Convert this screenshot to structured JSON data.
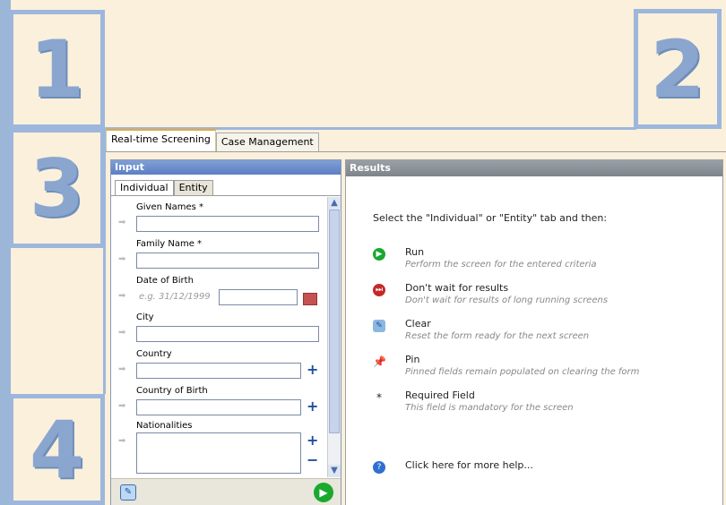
{
  "callouts": {
    "one": "1",
    "two": "2",
    "three": "3",
    "four": "4"
  },
  "tabs": [
    {
      "label": "Real-time Screening",
      "active": true
    },
    {
      "label": "Case Management",
      "active": false
    }
  ],
  "input_panel": {
    "title": "Input",
    "subtabs": [
      {
        "label": "Individual",
        "active": true
      },
      {
        "label": "Entity",
        "active": false
      }
    ],
    "fields": {
      "given_names": "Given Names *",
      "family_name": "Family Name *",
      "date_of_birth": "Date of Birth",
      "dob_placeholder": "e.g. 31/12/1999",
      "city": "City",
      "country": "Country",
      "country_of_birth": "Country of Birth",
      "nationalities": "Nationalities"
    },
    "add_symbol": "+",
    "remove_symbol": "−"
  },
  "results_panel": {
    "title": "Results",
    "instruction": "Select the \"Individual\" or \"Entity\" tab and then:",
    "legend": [
      {
        "title": "Run",
        "desc": "Perform the screen for the entered criteria",
        "icon": "run-icon"
      },
      {
        "title": "Don't wait for results",
        "desc": "Don't wait for results of long running screens",
        "icon": "skip-icon"
      },
      {
        "title": "Clear",
        "desc": "Reset the form ready for the next screen",
        "icon": "clear-icon"
      },
      {
        "title": "Pin",
        "desc": "Pinned fields remain populated on clearing the form",
        "icon": "pin-icon"
      },
      {
        "title": "Required Field",
        "desc": "This field is mandatory for the screen",
        "symbol": "*"
      }
    ],
    "help": "Click here for more help..."
  },
  "colors": {
    "callout_border": "#9db7dc",
    "background": "#fbf0dc",
    "run": "#1aa82e",
    "stop": "#c62828"
  }
}
